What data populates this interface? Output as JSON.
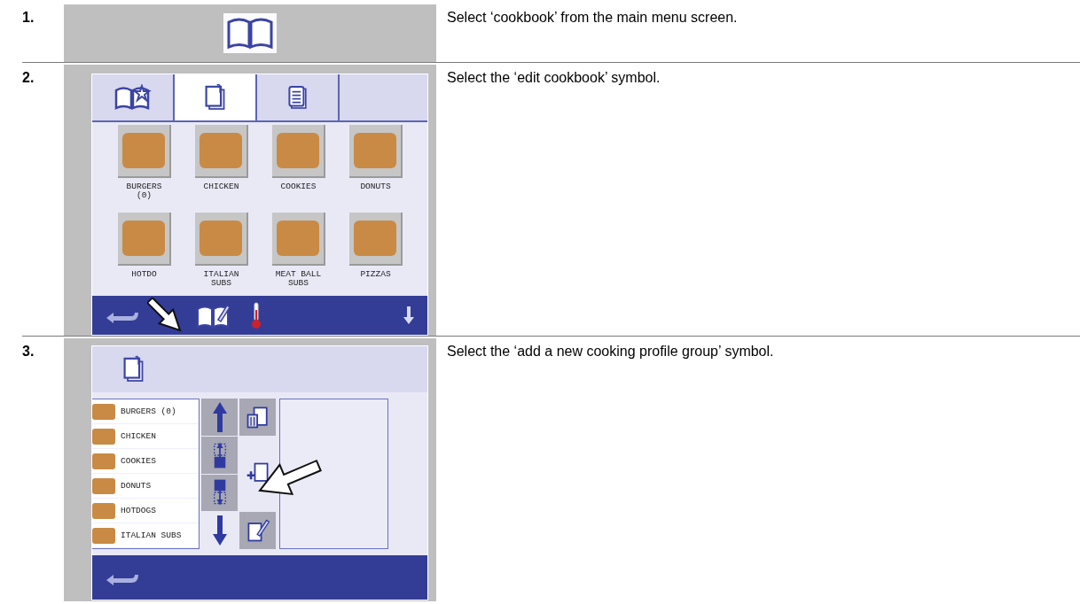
{
  "steps": [
    {
      "number": "1.",
      "instruction": "Select ‘cookbook’ from the main menu screen."
    },
    {
      "number": "2.",
      "instruction": "Select the ‘edit cookbook’ symbol."
    },
    {
      "number": "3.",
      "instruction": "Select the ‘add a new cooking profile group’ symbol."
    }
  ],
  "cookbook_screen": {
    "tabs": [
      {
        "kind": "favorites",
        "selected": false
      },
      {
        "kind": "edit",
        "selected": true
      },
      {
        "kind": "list",
        "selected": false
      }
    ],
    "categories": [
      {
        "label": "BURGERS (0)"
      },
      {
        "label": "CHICKEN"
      },
      {
        "label": "COOKIES"
      },
      {
        "label": "DONUTS"
      },
      {
        "label": "HOTDO"
      },
      {
        "label": "ITALIAN SUBS"
      },
      {
        "label": "MEAT BALL SUBS"
      },
      {
        "label": "PIZZAS"
      }
    ]
  },
  "edit_screen": {
    "groups": [
      {
        "label": "BURGERS (0)"
      },
      {
        "label": "CHICKEN"
      },
      {
        "label": "COOKIES"
      },
      {
        "label": "DONUTS"
      },
      {
        "label": "HOTDOGS"
      },
      {
        "label": "ITALIAN SUBS"
      }
    ]
  }
}
